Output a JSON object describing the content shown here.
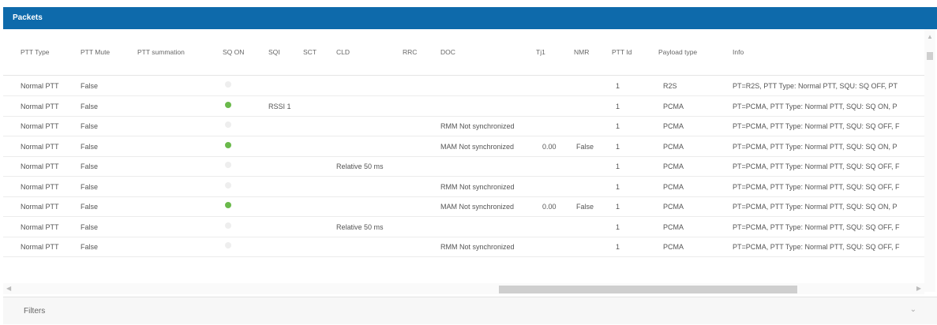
{
  "panel": {
    "title": "Packets"
  },
  "columns": [
    {
      "label": "PTT Type"
    },
    {
      "label": "PTT Mute"
    },
    {
      "label": "PTT summation"
    },
    {
      "label": "SQ ON"
    },
    {
      "label": "SQI"
    },
    {
      "label": "SCT"
    },
    {
      "label": "CLD"
    },
    {
      "label": "RRC"
    },
    {
      "label": "DOC"
    },
    {
      "label": "Tj1"
    },
    {
      "label": "NMR"
    },
    {
      "label": "PTT Id"
    },
    {
      "label": "Payload type"
    },
    {
      "label": "Info"
    }
  ],
  "rows": [
    {
      "ptt_type": "Normal PTT",
      "ptt_mute": "False",
      "ptt_summation": "",
      "sq_on": false,
      "sqi": "",
      "sct": "",
      "cld": "",
      "rrc": "",
      "doc": "",
      "tj1": "",
      "nmr": "",
      "ptt_id": "1",
      "payload_type": "R2S",
      "info": "PT=R2S, PTT Type: Normal PTT, SQU: SQ OFF, PT"
    },
    {
      "ptt_type": "Normal PTT",
      "ptt_mute": "False",
      "ptt_summation": "",
      "sq_on": true,
      "sqi": "RSSI 1",
      "sct": "",
      "cld": "",
      "rrc": "",
      "doc": "",
      "tj1": "",
      "nmr": "",
      "ptt_id": "1",
      "payload_type": "PCMA",
      "info": "PT=PCMA, PTT Type: Normal PTT, SQU: SQ ON, P"
    },
    {
      "ptt_type": "Normal PTT",
      "ptt_mute": "False",
      "ptt_summation": "",
      "sq_on": false,
      "sqi": "",
      "sct": "",
      "cld": "",
      "rrc": "",
      "doc": "RMM Not synchronized",
      "tj1": "",
      "nmr": "",
      "ptt_id": "1",
      "payload_type": "PCMA",
      "info": "PT=PCMA, PTT Type: Normal PTT, SQU: SQ OFF, F"
    },
    {
      "ptt_type": "Normal PTT",
      "ptt_mute": "False",
      "ptt_summation": "",
      "sq_on": true,
      "sqi": "",
      "sct": "",
      "cld": "",
      "rrc": "",
      "doc": "MAM Not synchronized",
      "tj1": "0.00",
      "nmr": "False",
      "ptt_id": "1",
      "payload_type": "PCMA",
      "info": "PT=PCMA, PTT Type: Normal PTT, SQU: SQ ON, P"
    },
    {
      "ptt_type": "Normal PTT",
      "ptt_mute": "False",
      "ptt_summation": "",
      "sq_on": false,
      "sqi": "",
      "sct": "",
      "cld": "Relative 50 ms",
      "rrc": "",
      "doc": "",
      "tj1": "",
      "nmr": "",
      "ptt_id": "1",
      "payload_type": "PCMA",
      "info": "PT=PCMA, PTT Type: Normal PTT, SQU: SQ OFF, F"
    },
    {
      "ptt_type": "Normal PTT",
      "ptt_mute": "False",
      "ptt_summation": "",
      "sq_on": false,
      "sqi": "",
      "sct": "",
      "cld": "",
      "rrc": "",
      "doc": "RMM Not synchronized",
      "tj1": "",
      "nmr": "",
      "ptt_id": "1",
      "payload_type": "PCMA",
      "info": "PT=PCMA, PTT Type: Normal PTT, SQU: SQ OFF, F"
    },
    {
      "ptt_type": "Normal PTT",
      "ptt_mute": "False",
      "ptt_summation": "",
      "sq_on": true,
      "sqi": "",
      "sct": "",
      "cld": "",
      "rrc": "",
      "doc": "MAM Not synchronized",
      "tj1": "0.00",
      "nmr": "False",
      "ptt_id": "1",
      "payload_type": "PCMA",
      "info": "PT=PCMA, PTT Type: Normal PTT, SQU: SQ ON, P"
    },
    {
      "ptt_type": "Normal PTT",
      "ptt_mute": "False",
      "ptt_summation": "",
      "sq_on": false,
      "sqi": "",
      "sct": "",
      "cld": "Relative 50 ms",
      "rrc": "",
      "doc": "",
      "tj1": "",
      "nmr": "",
      "ptt_id": "1",
      "payload_type": "PCMA",
      "info": "PT=PCMA, PTT Type: Normal PTT, SQU: SQ OFF, F"
    },
    {
      "ptt_type": "Normal PTT",
      "ptt_mute": "False",
      "ptt_summation": "",
      "sq_on": false,
      "sqi": "",
      "sct": "",
      "cld": "",
      "rrc": "",
      "doc": "RMM Not synchronized",
      "tj1": "",
      "nmr": "",
      "ptt_id": "1",
      "payload_type": "PCMA",
      "info": "PT=PCMA, PTT Type: Normal PTT, SQU: SQ OFF, F"
    }
  ],
  "filters": {
    "label": "Filters"
  },
  "colors": {
    "header_bg": "#0e6aab",
    "sq_on": "#6ab94b",
    "sq_off": "#eeeeee"
  },
  "icons": {
    "scroll_left": "chevron-left-icon",
    "scroll_right": "chevron-right-icon",
    "filters_toggle": "chevron-down-icon"
  }
}
